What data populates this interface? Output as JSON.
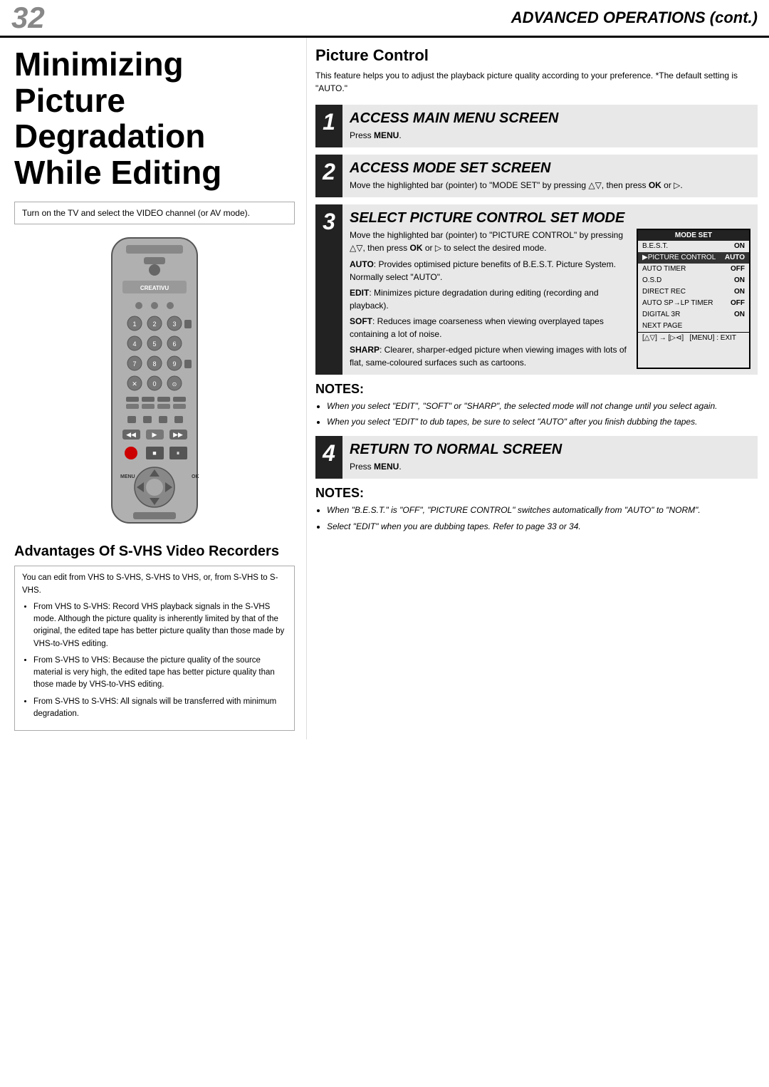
{
  "header": {
    "page_number": "32",
    "title": "ADVANCED OPERATIONS (cont.)"
  },
  "left_col": {
    "page_title": "Minimizing Picture Degradation While Editing",
    "intro_text": "Turn on the TV and select the VIDEO channel (or AV mode).",
    "advantages_title": "Advantages Of S-VHS Video Recorders",
    "advantages_intro": "You can edit from VHS to S-VHS, S-VHS to VHS, or, from S-VHS to S-VHS.",
    "advantages_bullets": [
      "From VHS to S-VHS: Record VHS playback signals in the S-VHS mode. Although the picture quality is inherently limited by that of the original, the edited tape has better picture quality than those made by VHS-to-VHS editing.",
      "From S-VHS to VHS: Because the picture quality of the source material is very high, the edited tape has better picture quality than those made by VHS-to-VHS editing.",
      "From S-VHS to S-VHS: All signals will be transferred with minimum degradation."
    ]
  },
  "right_col": {
    "picture_control_title": "Picture Control",
    "picture_control_desc": "This feature helps you to adjust the playback picture quality according to your preference. *The default setting is \"AUTO.\"",
    "steps": [
      {
        "num": "1",
        "heading": "ACCESS MAIN MENU SCREEN",
        "desc": "Press MENU."
      },
      {
        "num": "2",
        "heading": "ACCESS MODE SET SCREEN",
        "desc": "Move the highlighted bar (pointer) to \"MODE SET\" by pressing △▽, then press OK or ▷."
      },
      {
        "num": "3",
        "heading": "SELECT PICTURE CONTROL SET MODE",
        "desc_pre": "Move the highlighted bar (pointer) to \"PICTURE CONTROL\" by pressing △▽, then press OK or ▷ to select the desired mode.",
        "modes": [
          {
            "label": "AUTO",
            "desc": "Provides optimised picture benefits of B.E.S.T. Picture System. Normally select \"AUTO\"."
          },
          {
            "label": "EDIT",
            "desc": "Minimizes picture degradation during editing (recording and playback)."
          },
          {
            "label": "SOFT",
            "desc": "Reduces image coarseness when viewing overplayed tapes containing a lot of noise."
          },
          {
            "label": "SHARP",
            "desc": "Clearer, sharper-edged picture when viewing images with lots of flat, same-coloured surfaces such as cartoons."
          }
        ],
        "mode_set_table": {
          "header": "MODE SET",
          "rows": [
            {
              "label": "B.E.S.T.",
              "val": "ON",
              "highlighted": false
            },
            {
              "label": "▶PICTURE CONTROL",
              "val": "AUTO",
              "highlighted": true
            },
            {
              "label": "AUTO TIMER",
              "val": "OFF",
              "highlighted": false
            },
            {
              "label": "O.S.D",
              "val": "ON",
              "highlighted": false
            },
            {
              "label": "DIRECT REC",
              "val": "ON",
              "highlighted": false
            },
            {
              "label": "AUTO SP→LP TIMER",
              "val": "OFF",
              "highlighted": false
            },
            {
              "label": "DIGITAL 3R",
              "val": "ON",
              "highlighted": false
            },
            {
              "label": "NEXT PAGE",
              "val": "",
              "highlighted": false
            }
          ],
          "footer": "[△▽] → [▷⊲]   [MENU] : EXIT"
        }
      },
      {
        "num": "4",
        "heading": "RETURN TO NORMAL SCREEN",
        "desc": "Press MENU."
      }
    ],
    "notes_mid": {
      "title": "NOTES:",
      "items": [
        "When you select \"EDIT\", \"SOFT\" or \"SHARP\", the selected mode will not change until you select again.",
        "When you select \"EDIT\" to dub tapes, be sure to select \"AUTO\" after you finish dubbing the tapes."
      ]
    },
    "notes_bottom": {
      "title": "NOTES:",
      "items": [
        "When \"B.E.S.T.\" is \"OFF\", \"PICTURE CONTROL\" switches automatically from \"AUTO\" to \"NORM\".",
        "Select \"EDIT\" when you are dubbing tapes. Refer to page 33 or 34."
      ]
    }
  }
}
